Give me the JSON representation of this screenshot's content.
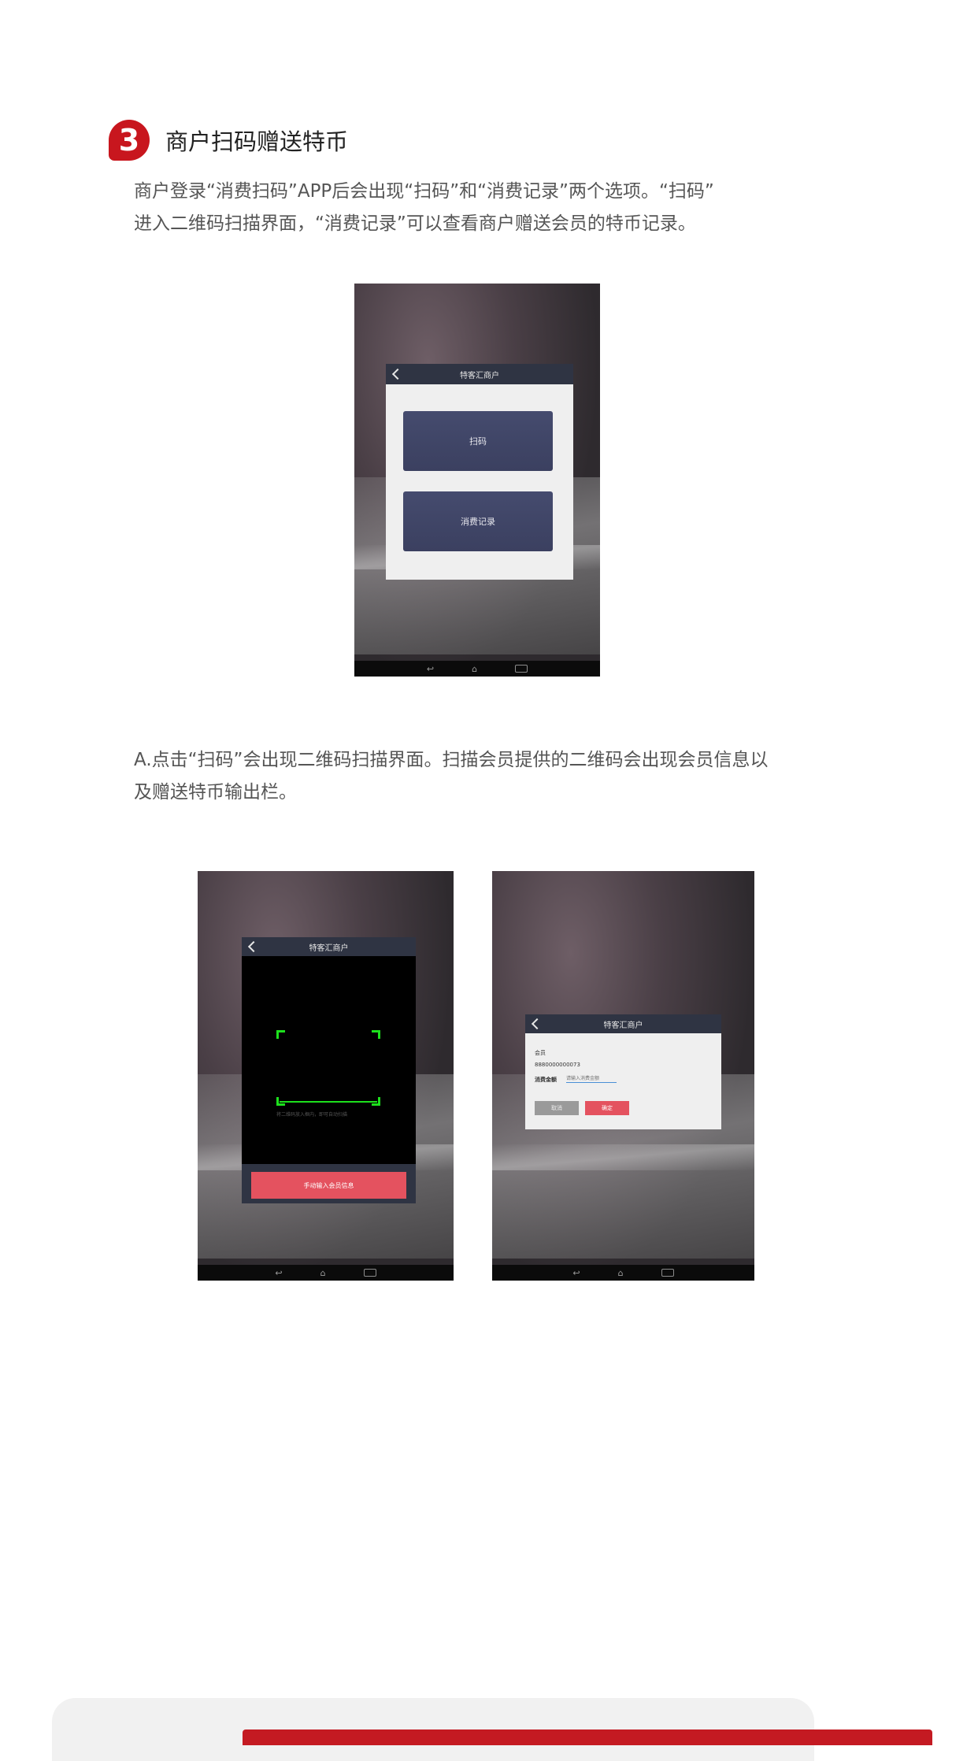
{
  "section": {
    "number": "3",
    "title": "商户扫码赠送特币",
    "intro": [
      "商户登录“消费扫码”APP后会出现“扫码”和“消费记录”两个选项。“扫码”",
      "进入二维码扫描界面，“消费记录”可以查看商户赠送会员的特币记录。"
    ],
    "step_a": [
      "A.点击“扫码”会出现二维码扫描界面。扫描会员提供的二维码会出现会员信息以",
      "及赠送特币输出栏。"
    ]
  },
  "screen_menu": {
    "bar_title": "特客汇商户",
    "buttons": [
      "扫码",
      "消费记录"
    ]
  },
  "screen_scan": {
    "bar_title": "特客汇商户",
    "hint": "将二维码放入框内，即可自动扫描",
    "manual_button": "手动输入会员信息"
  },
  "screen_member": {
    "bar_title": "特客汇商户",
    "member_label": "会员",
    "member_id": "8880000000073",
    "amount_label": "消费金额",
    "amount_placeholder": "请输入消费金额",
    "cancel": "取消",
    "confirm": "确定"
  },
  "nav_icons": [
    "back-nav-icon",
    "home-nav-icon",
    "recent-apps-icon"
  ],
  "colors": {
    "accent": "#c8161e",
    "dialog_bar": "#2f3443",
    "button_primary": "#454b6e",
    "button_alert": "#e4525f",
    "scan_frame": "#1de01d"
  }
}
